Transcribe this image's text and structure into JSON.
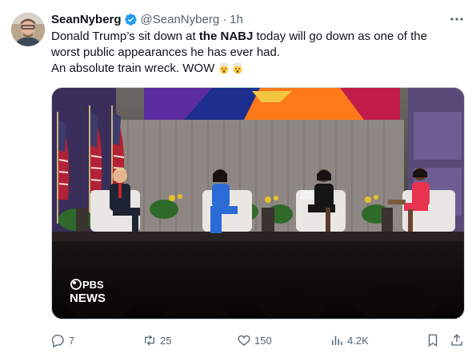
{
  "tweet": {
    "author_name": "SeanNyberg",
    "handle": "@SeanNyberg",
    "separator": "·",
    "time": "1h",
    "text_line1_before": "Donald Trump’s sit down at ",
    "text_line1_bold": "the NABJ",
    "text_line1_after": " today will go down as one of the",
    "text_line2": "worst public appearances he has ever had.",
    "text_line3": "An absolute train wreck. WOW",
    "emojis": [
      "exploding-head-emoji",
      "exploding-head-emoji"
    ]
  },
  "media": {
    "watermark_line1": "PBS",
    "watermark_line2": "NEWS",
    "description_icon": "video-frame"
  },
  "actions": {
    "reply_count": "7",
    "retweet_count": "25",
    "like_count": "150",
    "views_count": "4.2K"
  },
  "icons": {
    "verified": "verified-badge-icon",
    "more": "more-dots-icon",
    "reply": "reply-icon",
    "retweet": "retweet-icon",
    "like": "heart-icon",
    "views": "views-icon",
    "bookmark": "bookmark-icon",
    "share": "share-icon"
  },
  "colors": {
    "verified": "#1d9bf0",
    "text": "#0f1419",
    "secondary": "#536471"
  }
}
